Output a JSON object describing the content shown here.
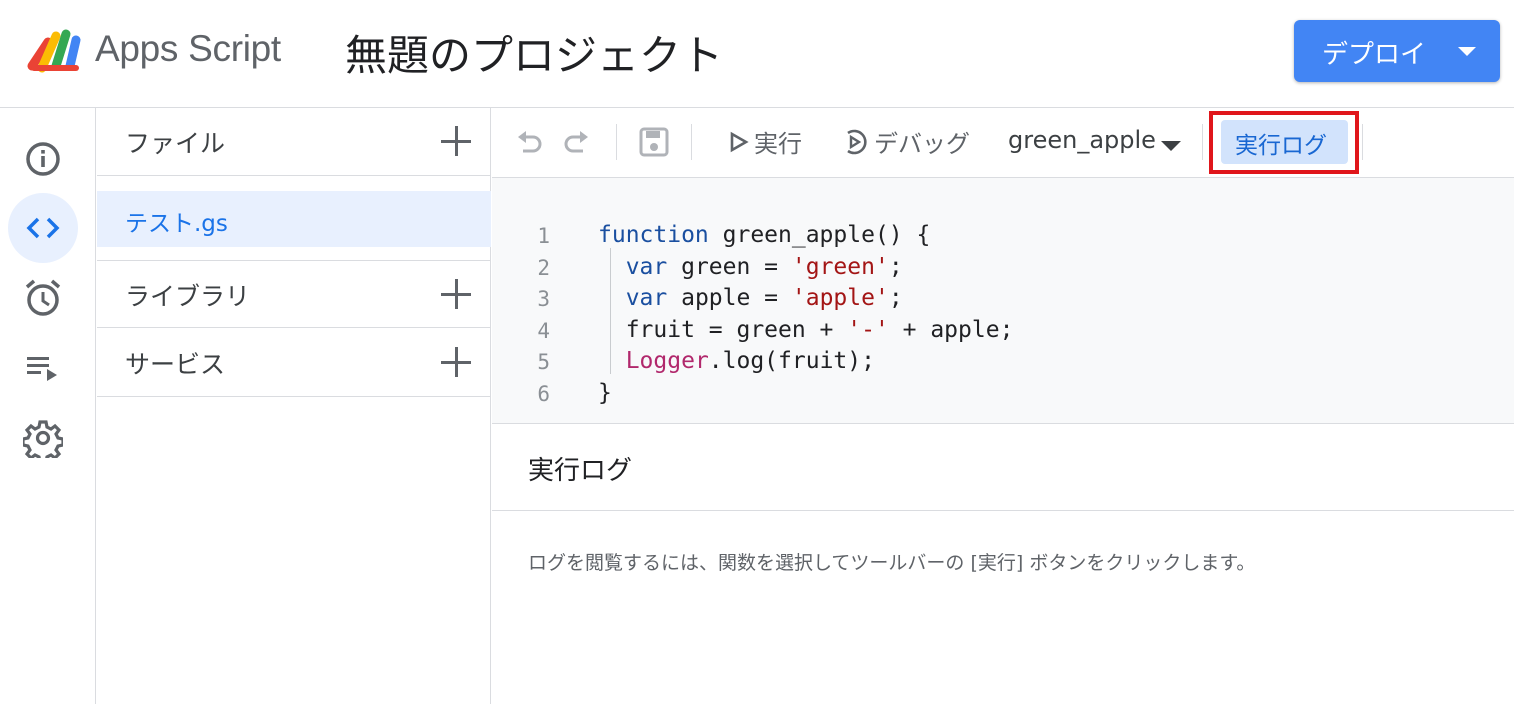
{
  "header": {
    "app_name": "Apps Script",
    "project_title": "無題のプロジェクト",
    "deploy_label": "デプロイ"
  },
  "rail": {
    "items": [
      {
        "name": "overview",
        "icon": "info-icon"
      },
      {
        "name": "editor",
        "icon": "code-icon",
        "active": true
      },
      {
        "name": "triggers",
        "icon": "alarm-clock-icon"
      },
      {
        "name": "executions",
        "icon": "playlist-play-icon"
      },
      {
        "name": "settings",
        "icon": "gear-icon"
      }
    ]
  },
  "files_panel": {
    "files_header": "ファイル",
    "file_name": "テスト.gs",
    "libraries_header": "ライブラリ",
    "services_header": "サービス"
  },
  "toolbar": {
    "run_label": "実行",
    "debug_label": "デバッグ",
    "function_name": "green_apple",
    "log_label": "実行ログ"
  },
  "code": {
    "line_numbers": [
      "1",
      "2",
      "3",
      "4",
      "5",
      "6"
    ],
    "lines": [
      [
        {
          "t": "function",
          "c": "kw"
        },
        {
          "t": " green_apple() {",
          "c": ""
        }
      ],
      [
        {
          "t": "  ",
          "c": ""
        },
        {
          "t": "var",
          "c": "kw"
        },
        {
          "t": " green = ",
          "c": ""
        },
        {
          "t": "'green'",
          "c": "str"
        },
        {
          "t": ";",
          "c": ""
        }
      ],
      [
        {
          "t": "  ",
          "c": ""
        },
        {
          "t": "var",
          "c": "kw"
        },
        {
          "t": " apple = ",
          "c": ""
        },
        {
          "t": "'apple'",
          "c": "str"
        },
        {
          "t": ";",
          "c": ""
        }
      ],
      [
        {
          "t": "  fruit = green + ",
          "c": ""
        },
        {
          "t": "'-'",
          "c": "str"
        },
        {
          "t": " + apple;",
          "c": ""
        }
      ],
      [
        {
          "t": "  ",
          "c": ""
        },
        {
          "t": "Logger",
          "c": "obj"
        },
        {
          "t": ".log(fruit);",
          "c": ""
        }
      ],
      [
        {
          "t": "}",
          "c": ""
        }
      ]
    ]
  },
  "log_panel": {
    "title": "実行ログ",
    "message": "ログを閲覧するには、関数を選択してツールバーの [実行] ボタンをクリックします。"
  },
  "colors": {
    "accent": "#4285f4",
    "active_bg": "#e8f0fe",
    "highlight_frame": "#e0161b"
  }
}
